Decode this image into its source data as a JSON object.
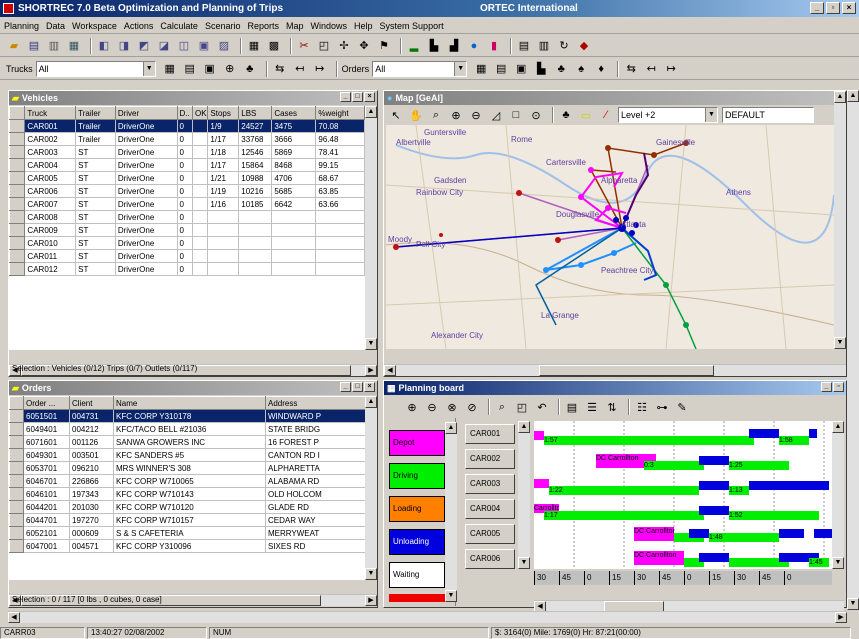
{
  "app": {
    "title": "SHORTREC 7.0 Beta   Optimization and Planning of Trips",
    "company": "ORTEC International"
  },
  "menu": [
    "Planning",
    "Data",
    "Workspace",
    "Actions",
    "Calculate",
    "Scenario",
    "Reports",
    "Map",
    "Windows",
    "Help",
    "System Support"
  ],
  "filters": {
    "trucks_label": "Trucks",
    "trucks_value": "All",
    "orders_label": "Orders",
    "orders_value": "All"
  },
  "vehicles": {
    "title": "Vehicles",
    "columns": [
      "Truck",
      "Trailer",
      "Driver",
      "D..",
      "OK",
      "Stops",
      "LBS",
      "Cases",
      "%weight"
    ],
    "rows": [
      [
        "CAR001",
        "Trailer",
        "DriverOne",
        "0",
        "",
        "1/9",
        "24527",
        "3475",
        "70.08"
      ],
      [
        "CAR002",
        "Trailer",
        "DriverOne",
        "0",
        "",
        "1/17",
        "33768",
        "3666",
        "96.48"
      ],
      [
        "CAR003",
        "ST",
        "DriverOne",
        "0",
        "",
        "1/18",
        "12546",
        "5869",
        "78.41"
      ],
      [
        "CAR004",
        "ST",
        "DriverOne",
        "0",
        "",
        "1/17",
        "15864",
        "8468",
        "99.15"
      ],
      [
        "CAR005",
        "ST",
        "DriverOne",
        "0",
        "",
        "1/21",
        "10988",
        "4706",
        "68.67"
      ],
      [
        "CAR006",
        "ST",
        "DriverOne",
        "0",
        "",
        "1/19",
        "10216",
        "5685",
        "63.85"
      ],
      [
        "CAR007",
        "ST",
        "DriverOne",
        "0",
        "",
        "1/16",
        "10185",
        "6642",
        "63.66"
      ],
      [
        "CAR008",
        "ST",
        "DriverOne",
        "0",
        "",
        "",
        "",
        "",
        ""
      ],
      [
        "CAR009",
        "ST",
        "DriverOne",
        "0",
        "",
        "",
        "",
        "",
        ""
      ],
      [
        "CAR010",
        "ST",
        "DriverOne",
        "0",
        "",
        "",
        "",
        "",
        ""
      ],
      [
        "CAR011",
        "ST",
        "DriverOne",
        "0",
        "",
        "",
        "",
        "",
        ""
      ],
      [
        "CAR012",
        "ST",
        "DriverOne",
        "0",
        "",
        "",
        "",
        "",
        ""
      ]
    ],
    "selection": "Selection : Vehicles (0/12) Trips (0/7) Outlets (0/117)"
  },
  "orders": {
    "title": "Orders",
    "columns": [
      "Order ...",
      "Client",
      "Name",
      "Address"
    ],
    "rows": [
      [
        "6051501",
        "004731",
        "KFC CORP Y310178",
        "WINDWARD P"
      ],
      [
        "6049401",
        "004212",
        "KFC/TACO BELL #21036",
        "STATE BRIDG"
      ],
      [
        "6071601",
        "001126",
        "SANWA GROWERS INC",
        "16 FOREST P"
      ],
      [
        "6049301",
        "003501",
        "KFC SANDERS #5",
        "CANTON RD I"
      ],
      [
        "6053701",
        "096210",
        "MRS WINNER'S 308",
        "ALPHARETTA"
      ],
      [
        "6046701",
        "226866",
        "KFC CORP W710065",
        "ALABAMA RD"
      ],
      [
        "6046101",
        "197343",
        "KFC CORP W710143",
        "OLD HOLCOM"
      ],
      [
        "6044201",
        "201030",
        "KFC CORP W710120",
        "GLADE RD"
      ],
      [
        "6044701",
        "197270",
        "KFC CORP W710157",
        "CEDAR WAY"
      ],
      [
        "6052101",
        "000609",
        "S & S CAFETERIA",
        "MERRYWEAT"
      ],
      [
        "6047001",
        "004571",
        "KFC CORP Y310096",
        "SIXES RD"
      ]
    ],
    "selection": "Selection : 0 / 117 [0 lbs , 0 cubes, 0 case]"
  },
  "map": {
    "title": "Map [GeAl]",
    "level": "Level +2",
    "layout": "DEFAULT",
    "cities": [
      "Guntersville",
      "Albertville",
      "Rome",
      "Cartersville",
      "Gainesville",
      "Alpharetta",
      "Gadsden",
      "Rainbow City",
      "Athens",
      "Douglasville",
      "Atlanta",
      "Moody",
      "Pell City",
      "Peachtree City",
      "La Grange",
      "Alexander City"
    ]
  },
  "planning": {
    "title": "Planning board",
    "legend": [
      "Depot",
      "Driving",
      "Loading",
      "Unloading",
      "Waiting"
    ],
    "legend_colors": [
      "#ff00ff",
      "#00ee00",
      "#ff8000",
      "#0000dd",
      "#ffffff"
    ],
    "trucks": [
      "CAR001",
      "CAR002",
      "CAR003",
      "CAR004",
      "CAR005",
      "CAR006"
    ],
    "bar_labels": [
      "1:57",
      "1:58",
      "DC Carrollton",
      "0:3",
      "1:25",
      "1:22",
      "1:13",
      "Carrollton",
      "1:17",
      "1:52",
      "1:48",
      "DC Carrollton",
      "1:45"
    ],
    "timeline": [
      "30",
      "45",
      "0",
      "15",
      "30",
      "45",
      "0",
      "15",
      "30",
      "45",
      "0"
    ]
  },
  "status": {
    "truck": "CARR03",
    "datetime": "13:40:27 02/08/2002",
    "num": "NUM",
    "summary": "$: 3164(0) Mile: 1769(0) Hr: 87:21(00:00)"
  }
}
